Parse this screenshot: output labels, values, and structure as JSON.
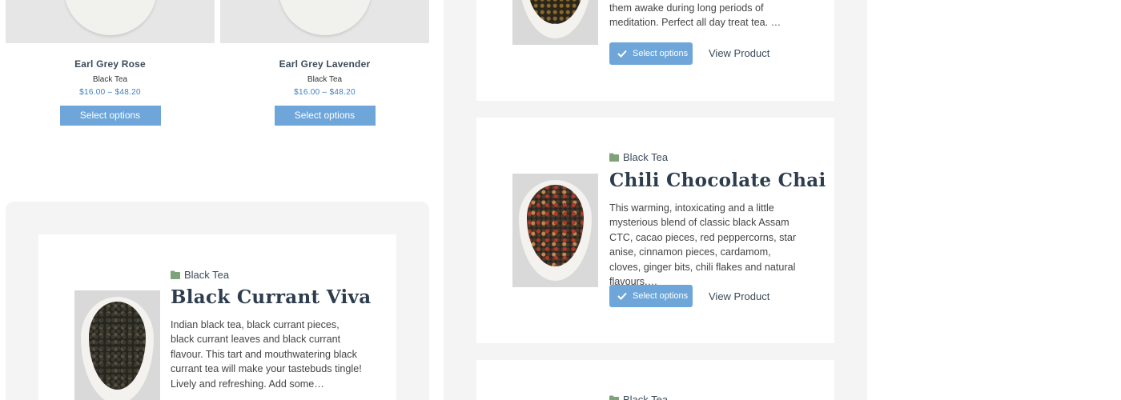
{
  "grid": [
    {
      "title": "Earl Grey Rose",
      "category": "Black Tea",
      "price": "$16.00 – $48.20",
      "button": "Select options"
    },
    {
      "title": "Earl Grey Lavender",
      "category": "Black Tea",
      "price": "$16.00 – $48.20",
      "button": "Select options"
    }
  ],
  "featured_left": {
    "category": "Black Tea",
    "title": "Black Currant Viva",
    "description": "Indian black tea, black currant pieces, black currant leaves and black currant flavour. This tart and mouthwatering black currant tea will make your tastebuds tingle! Lively and refreshing.  Add some…"
  },
  "featured_top": {
    "description": "them awake during long periods of meditation. Perfect all day treat tea. …",
    "button": "Select options",
    "link": "View Product"
  },
  "featured_middle": {
    "category": "Black Tea",
    "title": "Chili Chocolate Chai",
    "description": "This warming, intoxicating and a little mysterious blend of classic black Assam CTC, cacao pieces, red peppercorns, star anise, cinnamon pieces, cardamom, cloves, ginger bits, chili flakes and natural flavours.…",
    "button": "Select options",
    "link": "View Product"
  },
  "featured_bottom": {
    "category": "Black Tea"
  },
  "colors": {
    "button_blue": "#6fa6d9",
    "price_blue": "#3b7fbf",
    "title_dark": "#2e3d4d",
    "panel_gray": "#f4f4f4"
  },
  "icons": [
    "folder-icon",
    "check-icon"
  ]
}
